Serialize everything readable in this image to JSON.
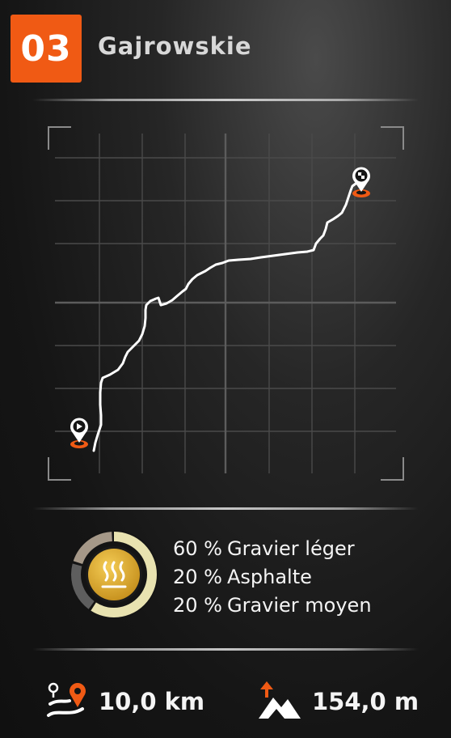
{
  "stage": {
    "number": "03",
    "name": "Gajrowskie"
  },
  "map": {
    "start_marker": "play-pin-icon",
    "finish_marker": "checkered-flag-pin-icon",
    "marker_color": "#f05a14"
  },
  "surfaces": {
    "icon": "heat-waves-icon",
    "items": [
      {
        "pct": "60 %",
        "label": "Gravier léger",
        "color": "#e8e2b0"
      },
      {
        "pct": "20 %",
        "label": "Asphalte",
        "color": "#5e5e5e"
      },
      {
        "pct": "20 %",
        "label": "Gravier moyen",
        "color": "#a59888"
      }
    ]
  },
  "stats": {
    "distance": {
      "icon": "route-distance-icon",
      "value": "10,0 km"
    },
    "elevation": {
      "icon": "elevation-gain-icon",
      "value": "154,0 m"
    }
  },
  "colors": {
    "accent": "#f05a14",
    "badge_text": "#ffffff",
    "gold": "#e0b233"
  }
}
